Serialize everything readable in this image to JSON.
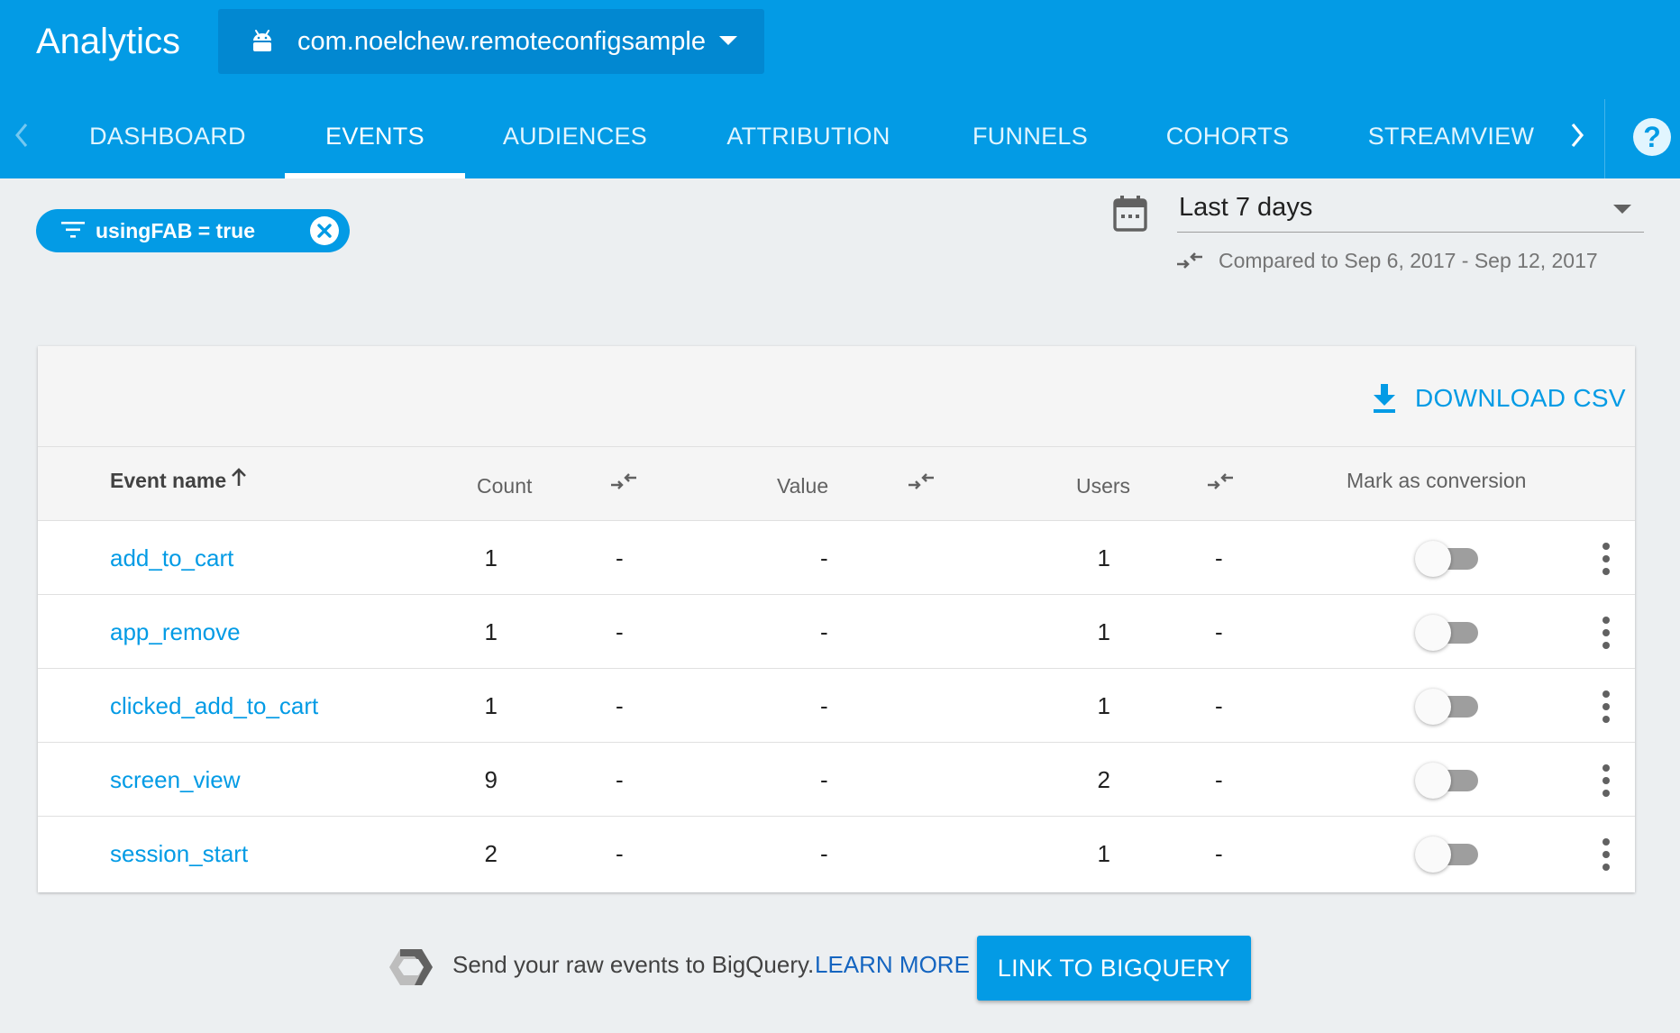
{
  "header": {
    "title": "Analytics",
    "app_selector": {
      "icon": "android-icon",
      "value": "com.noelchew.remoteconfigsample"
    },
    "tabs": [
      {
        "label": "DASHBOARD",
        "active": false
      },
      {
        "label": "EVENTS",
        "active": true
      },
      {
        "label": "AUDIENCES",
        "active": false
      },
      {
        "label": "ATTRIBUTION",
        "active": false
      },
      {
        "label": "FUNNELS",
        "active": false
      },
      {
        "label": "COHORTS",
        "active": false
      },
      {
        "label": "STREAMVIEW",
        "active": false
      }
    ],
    "help_glyph": "?"
  },
  "filter": {
    "label": "usingFAB = true",
    "icon": "filter-icon"
  },
  "date_range": {
    "value": "Last 7 days",
    "comparison": "Compared to Sep 6, 2017 - Sep 12, 2017"
  },
  "table": {
    "download_label": "DOWNLOAD CSV",
    "columns": {
      "event_name": "Event name",
      "count": "Count",
      "value": "Value",
      "users": "Users",
      "conversion": "Mark as conversion"
    },
    "rows": [
      {
        "name": "add_to_cart",
        "count": "1",
        "count_change": "-",
        "value": "-",
        "users": "1",
        "users_change": "-",
        "conversion": false
      },
      {
        "name": "app_remove",
        "count": "1",
        "count_change": "-",
        "value": "-",
        "users": "1",
        "users_change": "-",
        "conversion": false
      },
      {
        "name": "clicked_add_to_cart",
        "count": "1",
        "count_change": "-",
        "value": "-",
        "users": "1",
        "users_change": "-",
        "conversion": false
      },
      {
        "name": "screen_view",
        "count": "9",
        "count_change": "-",
        "value": "-",
        "users": "2",
        "users_change": "-",
        "conversion": false
      },
      {
        "name": "session_start",
        "count": "2",
        "count_change": "-",
        "value": "-",
        "users": "1",
        "users_change": "-",
        "conversion": false
      }
    ]
  },
  "bigquery": {
    "text": "Send your raw events to BigQuery.",
    "learn_more": "LEARN MORE",
    "button": "LINK TO BIGQUERY"
  },
  "colors": {
    "primary": "#039be5",
    "primary_dark": "#0288d1",
    "link": "#039be5",
    "background": "#eceff1"
  }
}
